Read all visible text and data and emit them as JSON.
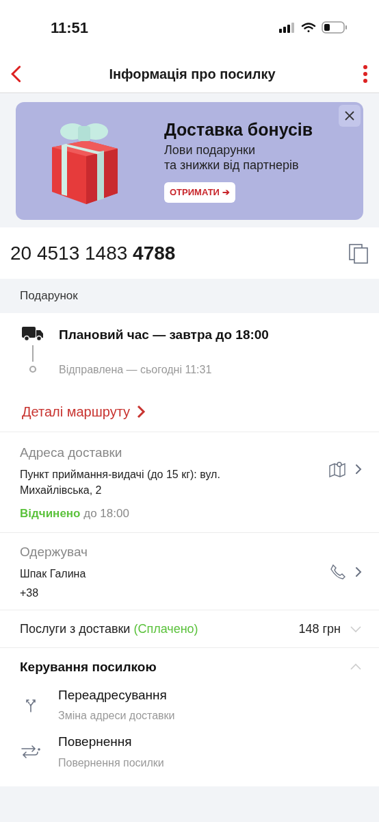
{
  "status_bar": {
    "time": "11:51"
  },
  "header": {
    "title": "Інформація про посилку"
  },
  "banner": {
    "title": "Доставка бонусів",
    "subtitle": "Лови подарунки\nта знижки від партнерів",
    "button": "ОТРИМАТИ ➔"
  },
  "tracking_number": "20 4513 1483 **4788**",
  "description": "Подарунок",
  "timeline": [
    {
      "kind": "current",
      "text": "Плановий час — завтра до 18:00"
    },
    {
      "kind": "past",
      "text": "Відправлена — сьогодні 11:31"
    }
  ],
  "route_link": "Деталі маршруту",
  "address": {
    "label": "Адреса доставки",
    "value": "Пункт приймання-видачі (до 15 кг): вул. Михайлівська, 2",
    "status": "Відчинено",
    "hours": "до 18:00"
  },
  "recipient": {
    "label": "Одержувач",
    "name": "Шпак Галина",
    "phone": "+38"
  },
  "services": {
    "label": "Послуги з доставки",
    "status": "(Сплачено)",
    "price": "148 грн",
    "expanded": false
  },
  "management": {
    "title": "Керування посилкою",
    "expanded": true,
    "actions": [
      {
        "kind": "redirect",
        "title": "Переадресування",
        "subtitle": "Зміна адреси доставки"
      },
      {
        "kind": "return",
        "title": "Повернення",
        "subtitle": "Повернення посилки"
      }
    ]
  }
}
